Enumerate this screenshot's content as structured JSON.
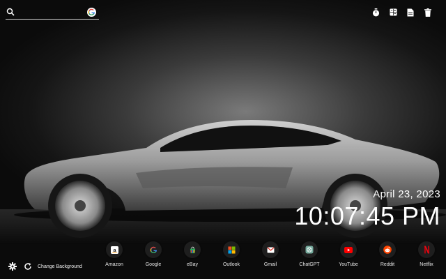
{
  "search": {
    "placeholder": "",
    "value": ""
  },
  "tools": [
    {
      "icon": "timer-icon"
    },
    {
      "icon": "calculator-icon"
    },
    {
      "icon": "notes-icon"
    },
    {
      "icon": "trash-icon"
    }
  ],
  "clock": {
    "date": "April 23, 2023",
    "time": "10:07:45 PM"
  },
  "shortcuts": [
    {
      "label": "Amazon",
      "icon": "amazon-icon"
    },
    {
      "label": "Google",
      "icon": "google-icon"
    },
    {
      "label": "eBay",
      "icon": "ebay-icon"
    },
    {
      "label": "Outlook",
      "icon": "outlook-icon"
    },
    {
      "label": "Gmail",
      "icon": "gmail-icon"
    },
    {
      "label": "ChatGPT",
      "icon": "chatgpt-icon"
    },
    {
      "label": "YouTube",
      "icon": "youtube-icon"
    },
    {
      "label": "Reddit",
      "icon": "reddit-icon"
    },
    {
      "label": "Netflix",
      "icon": "netflix-icon"
    }
  ],
  "footer": {
    "change_background_label": "Change Background"
  }
}
